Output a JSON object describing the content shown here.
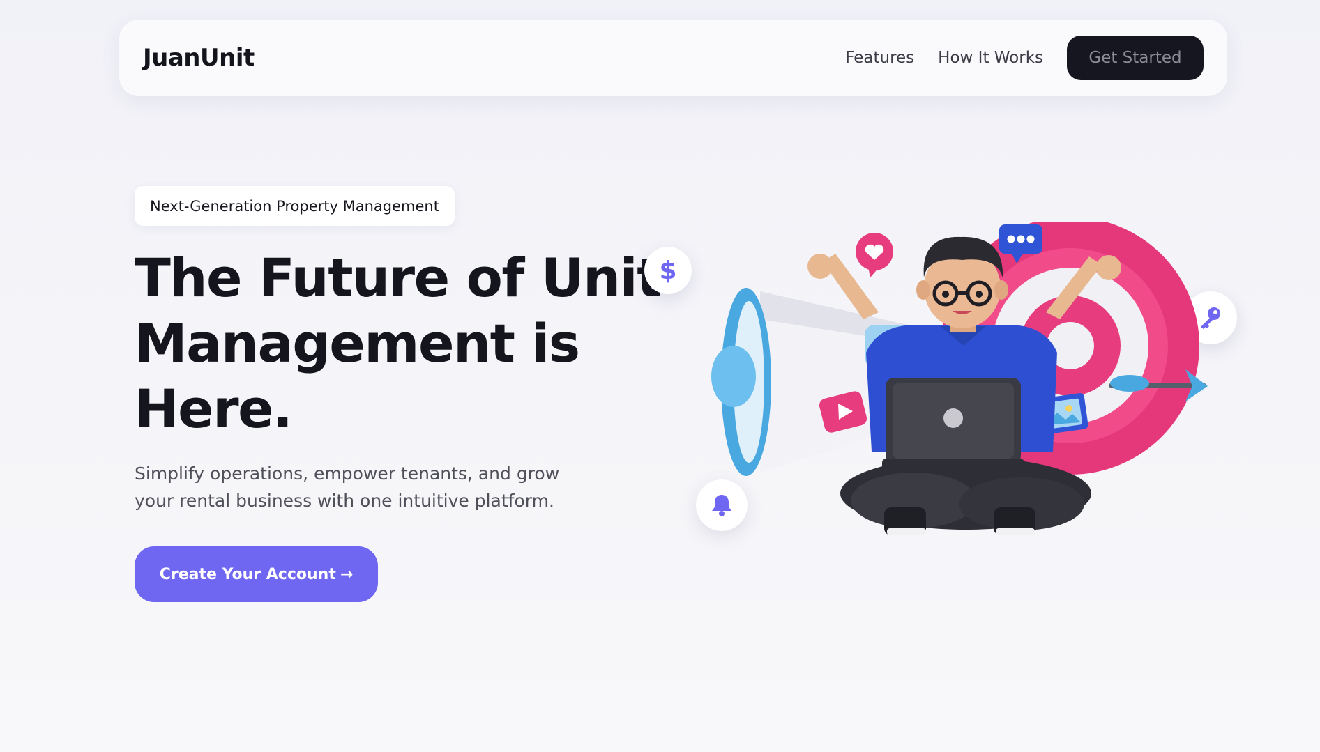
{
  "brand": {
    "name": "JuanUnit"
  },
  "nav": {
    "links": [
      "Features",
      "How It Works"
    ],
    "cta_label": "Get Started"
  },
  "hero": {
    "badge": "Next-Generation Property Management",
    "title": "The Future of Unit Management is Here.",
    "subtitle": "Simplify operations, empower tenants, and grow your rental business with one intuitive platform.",
    "cta_label": "Create Your Account",
    "cta_arrow": "→"
  },
  "floating_icons": [
    {
      "name": "dollar-icon",
      "glyph": "$"
    },
    {
      "name": "bell-icon"
    },
    {
      "name": "key-icon"
    }
  ],
  "illustration": {
    "name": "person-with-laptop-megaphone-target",
    "elements": [
      "megaphone",
      "target",
      "dart",
      "laptop",
      "heart-chat-bubble",
      "message-bubble",
      "play-button",
      "image-frame"
    ]
  },
  "colors": {
    "accent": "#6f66f1",
    "dark": "#161620",
    "pink": "#e73c7e",
    "blue": "#4aa8e0"
  }
}
